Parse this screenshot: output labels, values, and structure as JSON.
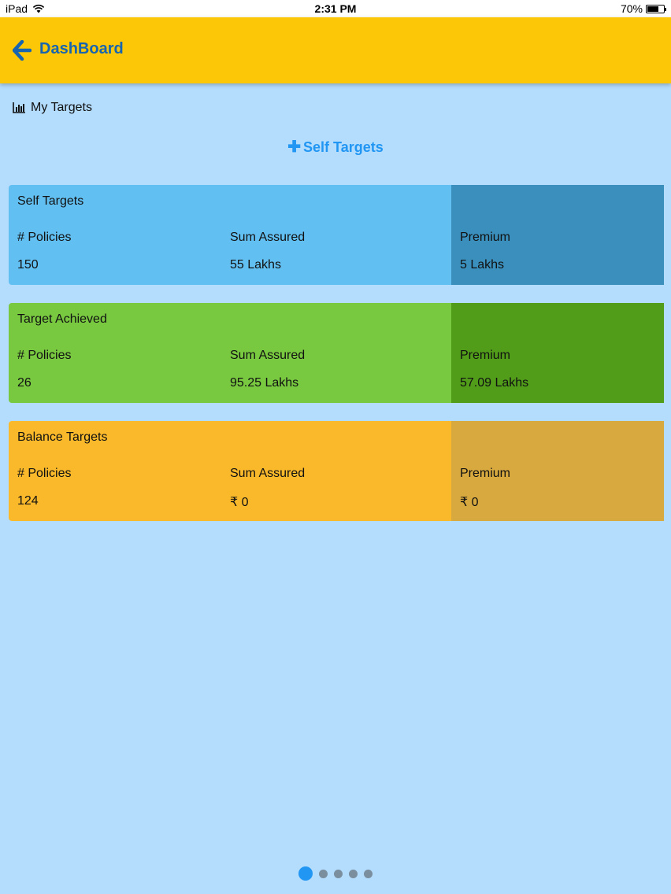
{
  "status_bar": {
    "device": "iPad",
    "time": "2:31 PM",
    "battery": "70%",
    "battery_level": 0.7
  },
  "header": {
    "title": "DashBoard",
    "back_icon": "arrow-left-icon",
    "background_color": "#fbc707",
    "title_color": "#1764b0"
  },
  "section": {
    "title": "My Targets",
    "icon": "bar-chart-icon"
  },
  "add_link": {
    "icon": "plus-icon",
    "label": "Self Targets",
    "color": "#2196f3"
  },
  "cards": [
    {
      "title": "Self Targets",
      "policies_label": "# Policies",
      "policies_value": "150",
      "sum_assured_label": "Sum Assured",
      "sum_assured_value": "55 Lakhs",
      "premium_label": "Premium",
      "premium_value": "5 Lakhs",
      "color_main": "#62bff1",
      "color_side": "#3a8fbc"
    },
    {
      "title": "Target Achieved",
      "policies_label": "# Policies",
      "policies_value": "26",
      "sum_assured_label": "Sum Assured",
      "sum_assured_value": "95.25 Lakhs",
      "premium_label": "Premium",
      "premium_value": "57.09 Lakhs",
      "color_main": "#78c840",
      "color_side": "#519d1a"
    },
    {
      "title": "Balance Targets",
      "policies_label": "# Policies",
      "policies_value": "124",
      "sum_assured_label": "Sum Assured",
      "sum_assured_value": "₹ 0",
      "premium_label": "Premium",
      "premium_value": "₹ 0",
      "color_main": "#fab92a",
      "color_side": "#d7a93f"
    }
  ],
  "pager": {
    "pages": 5,
    "current": 1,
    "active_color": "#2196f3"
  }
}
